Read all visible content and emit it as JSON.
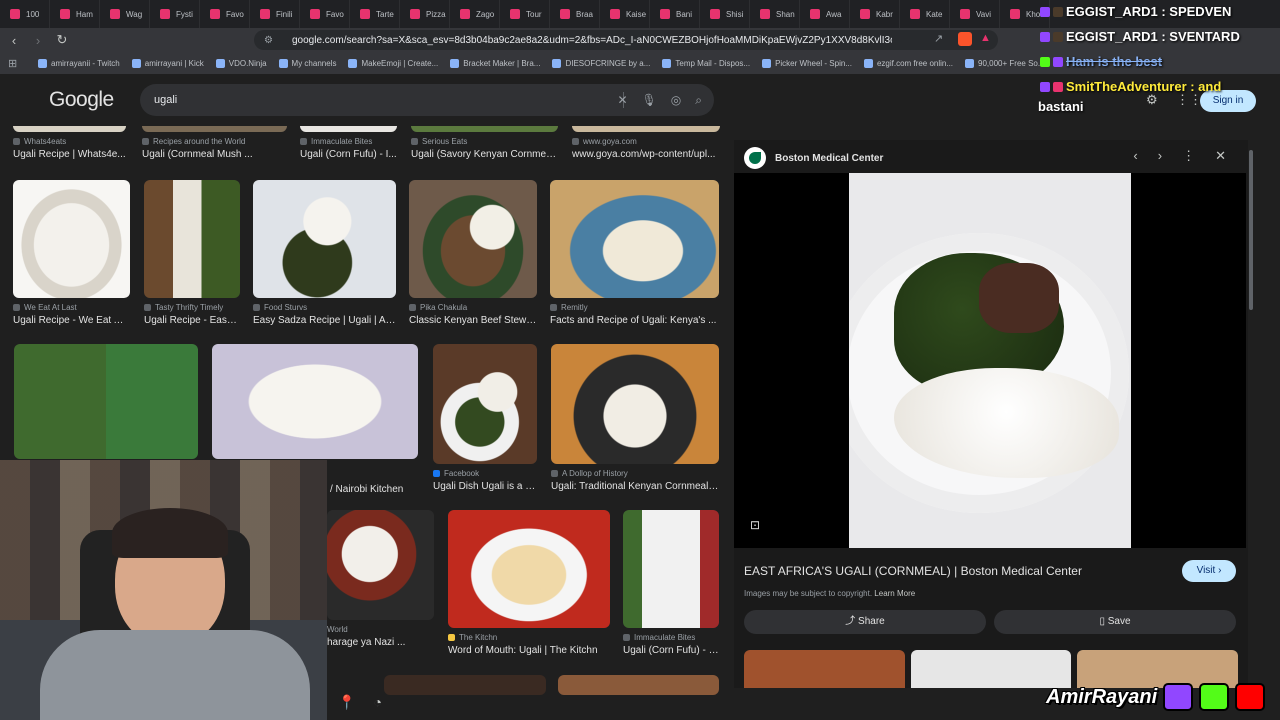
{
  "browser": {
    "tabs": [
      "100",
      "Ham",
      "Wag",
      "Fysti",
      "Favo",
      "Finili",
      "Favo",
      "Tarte",
      "Pizza",
      "Zago",
      "Tour",
      "Braa",
      "Kaise",
      "Bani",
      "Shisi",
      "Shan",
      "Awa",
      "Kabr",
      "Kate",
      "Vavi",
      "Khor"
    ],
    "url": "google.com/search?sa=X&sca_esv=8d3b04ba9c2ae8a2&udm=2&fbs=ADc_I-aN0CWEZBOHjofHoaMMDiKpaEWjvZ2Py1XXV8d8KvlI3o6iwGk6lv1tRbZ...",
    "bookmarks": [
      "amirrayanii - Twitch",
      "amirrayani | Kick",
      "VDO.Ninja",
      "My channels",
      "MakeEmoji | Create...",
      "Bracket Maker | Bra...",
      "DIESOFCRINGE by a...",
      "Temp Mail - Dispos...",
      "Picker Wheel - Spin...",
      "ezgif.com free onlin...",
      "90,000+ Free So..."
    ]
  },
  "google": {
    "logo": "Google",
    "query": "ugali",
    "sign_in": "Sign in"
  },
  "results": {
    "row0": [
      {
        "source": "Whats4eats",
        "title": "Ugali Recipe | Whats4e..."
      },
      {
        "source": "Recipes around the World",
        "title": "Ugali (Cornmeal Mush ..."
      },
      {
        "source": "Immaculate Bites",
        "title": "Ugali (Corn Fufu) - I..."
      },
      {
        "source": "Serious Eats",
        "title": "Ugali (Savory Kenyan Cornmeal ..."
      },
      {
        "source": "www.goya.com",
        "title": "www.goya.com/wp-content/upl..."
      }
    ],
    "row1": [
      {
        "source": "We Eat At Last",
        "title": "Ugali Recipe - We Eat At ..."
      },
      {
        "source": "Tasty Thrifty Timely",
        "title": "Ugali Recipe - Easy ..."
      },
      {
        "source": "Food Sturvs",
        "title": "Easy Sadza Recipe | Ugali | Afr..."
      },
      {
        "source": "Pika Chakula",
        "title": "Classic Kenyan Beef Stew ..."
      },
      {
        "source": "Remitly",
        "title": "Facts and Recipe of Ugali: Kenya's ..."
      }
    ],
    "row2": [
      {
        "source": "",
        "title": "/ Nairobi Kitchen"
      },
      {
        "source": "Facebook",
        "title": "Ugali Dish Ugali is a tr..."
      },
      {
        "source": "A Dollop of History",
        "title": "Ugali: Traditional Kenyan Cornmeal ..."
      }
    ],
    "row3": [
      {
        "source": "World",
        "title": "harage ya Nazi ..."
      },
      {
        "source": "The Kitchn",
        "title": "Word of Mouth: Ugali | The Kitchn"
      },
      {
        "source": "Immaculate Bites",
        "title": "Ugali (Corn Fufu) - I..."
      }
    ]
  },
  "preview": {
    "site": "Boston Medical Center",
    "title": "EAST AFRICA'S UGALI (CORNMEAL) | Boston Medical Center",
    "visit": "Visit",
    "copyright": "Images may be subject to copyright.",
    "learn_more": "Learn More",
    "share": "Share",
    "save": "Save"
  },
  "chat": [
    "EGGIST_ARD1 : SPEDVEN",
    "EGGIST_ARD1 : SVENTARD",
    "Ham is the best",
    "SmitTheAdventurer : and",
    "bastani"
  ],
  "brand": {
    "name": "AmirRayani"
  },
  "colors": {
    "page_bg": "#1f1f1f",
    "accent": "#c2e7ff",
    "chat_green": "#7CFC00"
  }
}
